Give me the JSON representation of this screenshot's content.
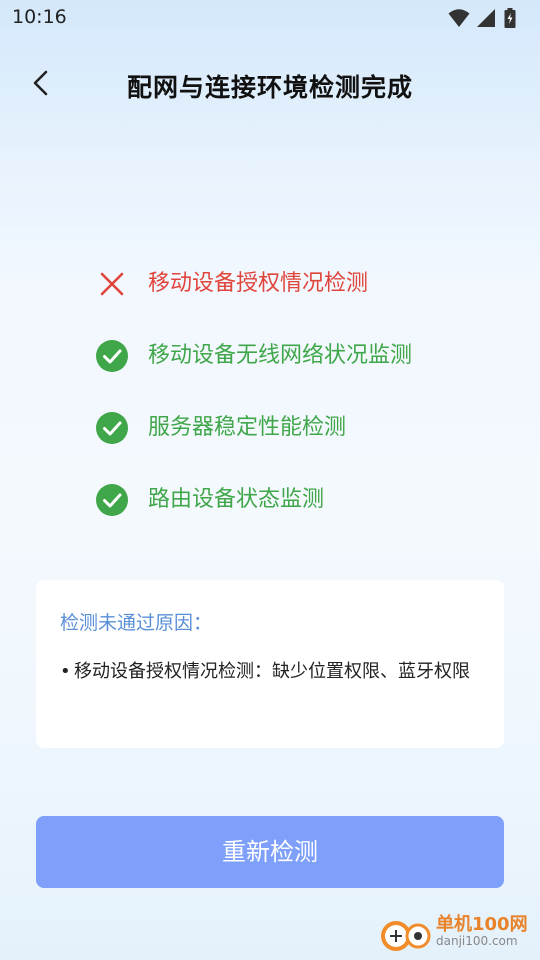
{
  "status_bar": {
    "time": "10:16"
  },
  "header": {
    "title": "配网与连接环境检测完成"
  },
  "checks": [
    {
      "label": "移动设备授权情况检测",
      "status": "fail"
    },
    {
      "label": "移动设备无线网络状况监测",
      "status": "pass"
    },
    {
      "label": "服务器稳定性能检测",
      "status": "pass"
    },
    {
      "label": "路由设备状态监测",
      "status": "pass"
    }
  ],
  "reason_card": {
    "title": "检测未通过原因：",
    "bullet": "•",
    "items": [
      "移动设备授权情况检测：缺少位置权限、蓝牙权限"
    ]
  },
  "actions": {
    "recheck_label": "重新检测"
  },
  "watermark": {
    "name": "单机100网",
    "url": "danji100.com"
  },
  "colors": {
    "fail": "#e0453c",
    "pass": "#3fa64a",
    "button": "#7e9ffa",
    "reason_title": "#5a8fd8"
  }
}
